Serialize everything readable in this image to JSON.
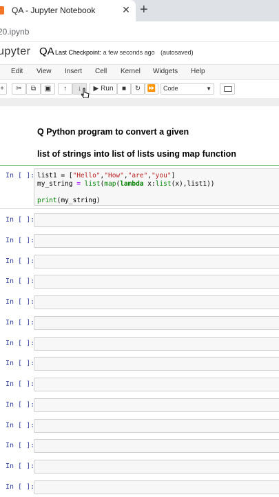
{
  "browser": {
    "tab_title": "QA - Jupyter Notebook",
    "close_glyph": "✕",
    "newtab_glyph": "+",
    "url": "20.ipynb"
  },
  "jupyter": {
    "logo_text": "upyter",
    "notebook_name": "QA",
    "checkpoint_label": "Last Checkpoint:",
    "checkpoint_time": "a few seconds ago",
    "autosave": "(autosaved)"
  },
  "menu": [
    "Edit",
    "View",
    "Insert",
    "Cell",
    "Kernel",
    "Widgets",
    "Help"
  ],
  "toolbar": {
    "run_label": "Run",
    "cell_type": "Code"
  },
  "markdown": {
    "line1": "Q Python program to convert a given",
    "line2": "list of strings into list of lists using map function"
  },
  "cells": {
    "prompt": "In [ ]:",
    "code": {
      "l1_a": "list1 = [",
      "l1_s1": "\"Hello\"",
      "l1_c1": ",",
      "l1_s2": "\"How\"",
      "l1_c2": ",",
      "l1_s3": "\"are\"",
      "l1_c3": ",",
      "l1_s4": "\"you\"",
      "l1_e": "]",
      "l2_a": "my_string ",
      "l2_eq": "=",
      "l2_b": " ",
      "l2_list": "list",
      "l2_p1": "(",
      "l2_map": "map",
      "l2_p2": "(",
      "l2_lambda": "lambda",
      "l2_c": " x:",
      "l2_list2": "list",
      "l2_d": "(x),l",
      "l2_e": "ist1))",
      "l4_print": "print",
      "l4_rest": "(my_string)"
    }
  }
}
